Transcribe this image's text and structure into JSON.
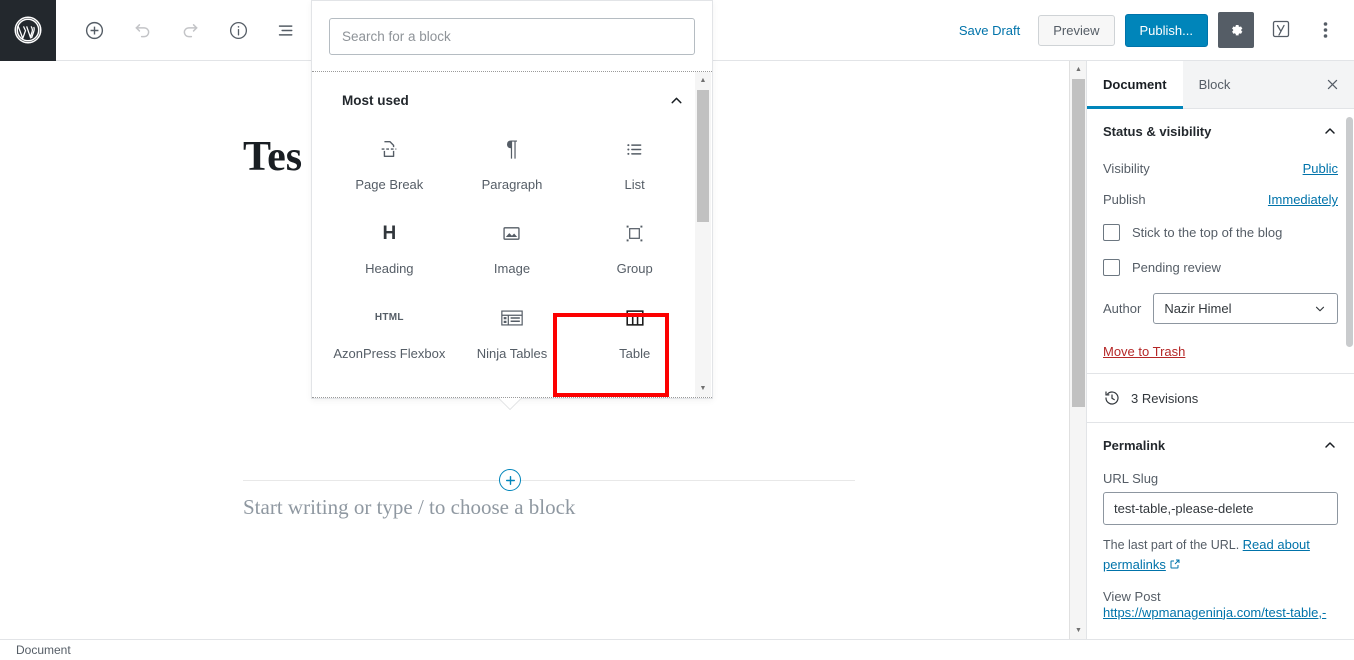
{
  "toolbar": {
    "logo_name": "wordpress-logo",
    "add_block_title": "Add block",
    "undo_title": "Undo",
    "redo_title": "Redo",
    "info_title": "Content structure",
    "list_view_title": "Block navigation",
    "edit_title": "Edit",
    "save_draft_label": "Save Draft",
    "preview_label": "Preview",
    "publish_label": "Publish...",
    "settings_title": "Settings",
    "yoast_title": "Yoast SEO",
    "more_title": "More tools & options"
  },
  "canvas": {
    "post_title": "Tes",
    "placeholder": "Start writing or type / to choose a block"
  },
  "inserter": {
    "search_placeholder": "Search for a block",
    "search_value": "",
    "category_label": "Most used",
    "blocks": [
      {
        "label": "Page Break",
        "icon": "page-break-icon"
      },
      {
        "label": "Paragraph",
        "icon": "paragraph-icon"
      },
      {
        "label": "List",
        "icon": "list-icon"
      },
      {
        "label": "Heading",
        "icon": "heading-icon"
      },
      {
        "label": "Image",
        "icon": "image-icon"
      },
      {
        "label": "Group",
        "icon": "group-icon"
      },
      {
        "label": "AzonPress Flexbox",
        "icon": "html-icon"
      },
      {
        "label": "Ninja Tables",
        "icon": "ninja-tables-icon"
      },
      {
        "label": "Table",
        "icon": "table-icon"
      }
    ],
    "highlight_color": "#fc0000",
    "highlighted_block": "Table"
  },
  "sidebar": {
    "tabs": [
      {
        "label": "Document",
        "active": true
      },
      {
        "label": "Block",
        "active": false
      }
    ],
    "close_title": "Close settings",
    "status": {
      "title": "Status & visibility",
      "visibility_label": "Visibility",
      "visibility_value": "Public",
      "publish_label": "Publish",
      "publish_value": "Immediately",
      "sticky_label": "Stick to the top of the blog",
      "pending_label": "Pending review",
      "author_label": "Author",
      "author_value": "Nazir Himel",
      "trash_label": "Move to Trash"
    },
    "revisions_label": "3 Revisions",
    "permalink": {
      "title": "Permalink",
      "slug_label": "URL Slug",
      "slug_value": "test-table,-please-delete",
      "help_text": "The last part of the URL.",
      "help_link": "Read about permalinks",
      "view_post_label": "View Post",
      "view_post_url": "https://wpmanageninja.com/test-table,-"
    }
  },
  "bottombar": {
    "breadcrumb": "Document"
  },
  "colors": {
    "accent": "#0085ba",
    "link": "#0073aa",
    "danger": "#b52727",
    "highlight": "#fc0000",
    "dark": "#23282d"
  }
}
